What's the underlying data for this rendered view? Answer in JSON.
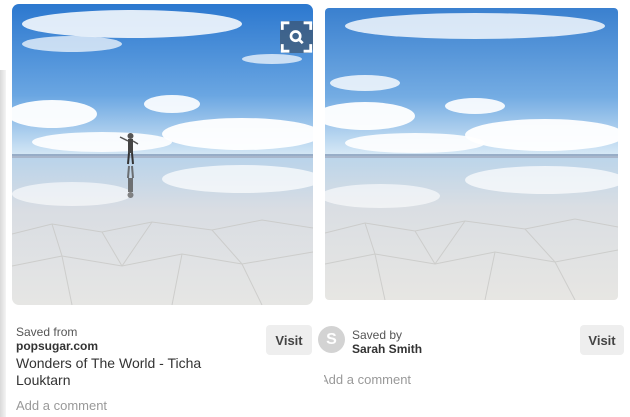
{
  "pins": [
    {
      "image_description_icon": "salt-flat-photo",
      "saved_from_label": "Saved from",
      "source": "popsugar.com",
      "title": "Wonders of The World - Ticha Louktarn",
      "visit_label": "Visit",
      "add_comment": "Add a comment"
    },
    {
      "image_description_icon": "salt-flat-photo",
      "saved_by_label": "Saved by",
      "saver_name": "Sarah Smith",
      "avatar_letter": "S",
      "visit_label": "Visit",
      "add_comment": "Add a comment"
    }
  ],
  "colors": {
    "sky_top": "#2f7fd3",
    "sky_horizon": "#cfe4f5",
    "salt": "#e8ebef",
    "button_bg": "#eeeeee",
    "muted_text": "#999999"
  }
}
